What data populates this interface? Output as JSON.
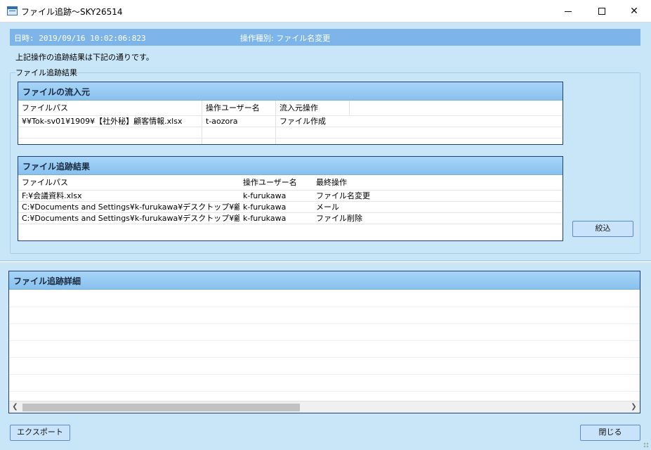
{
  "window": {
    "title": "ファイル追跡〜SKY26514",
    "minimize": "minimize",
    "maximize": "maximize",
    "close": "close"
  },
  "info": {
    "datetime": "日時: 2019/09/16 10:02:06:823",
    "operation": "操作種別: ファイル名変更"
  },
  "description": "上記操作の追跡結果は下記の通りです。",
  "group_label": "ファイル追跡結果",
  "source": {
    "header": "ファイルの流入元",
    "columns": [
      "ファイルパス",
      "操作ユーザー名",
      "流入元操作"
    ],
    "rows": [
      [
        "¥¥Tok-sv01¥1909¥【社外秘】顧客情報.xlsx",
        "t-aozora",
        "ファイル作成"
      ]
    ]
  },
  "results": {
    "header": "ファイル追跡結果",
    "columns": [
      "ファイルパス",
      "操作ユーザー名",
      "最終操作"
    ],
    "rows": [
      [
        "F:¥会議資料.xlsx",
        "k-furukawa",
        "ファイル名変更"
      ],
      [
        "C:¥Documents and Settings¥k-furukawa¥デスクトップ¥顧...",
        "k-furukawa",
        "メール"
      ],
      [
        "C:¥Documents and Settings¥k-furukawa¥デスクトップ¥顧...",
        "k-furukawa",
        "ファイル削除"
      ]
    ]
  },
  "buttons": {
    "filter": "絞込",
    "export": "エクスポート",
    "close": "閉じる"
  },
  "detail": {
    "header": "ファイル追跡詳細"
  },
  "colors": {
    "accent": "#7db5ea",
    "background": "#c9e6f8",
    "panel_border": "#1e3f7a"
  },
  "icons": {
    "app": "app-window-icon",
    "scroll_left": "scroll-left-icon",
    "scroll_right": "scroll-right-icon"
  }
}
